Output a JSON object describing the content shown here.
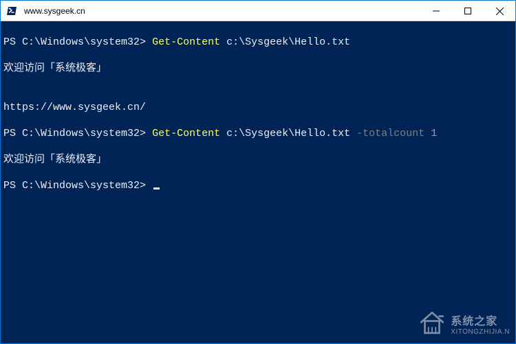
{
  "titlebar": {
    "title": "www.sysgeek.cn"
  },
  "terminal": {
    "prompt": "PS C:\\Windows\\system32>",
    "lines": [
      {
        "prompt": "PS C:\\Windows\\system32>",
        "cmd": "Get-Content",
        "arg": "c:\\Sysgeek\\Hello.txt",
        "flag": "",
        "num": ""
      },
      {
        "output": "欢迎访问「系统极客」"
      },
      {
        "output": ""
      },
      {
        "output": "https://www.sysgeek.cn/"
      },
      {
        "prompt": "PS C:\\Windows\\system32>",
        "cmd": "Get-Content",
        "arg": "c:\\Sysgeek\\Hello.txt",
        "flag": "-totalcount",
        "num": "1"
      },
      {
        "output": "欢迎访问「系统极客」"
      }
    ],
    "final_prompt": "PS C:\\Windows\\system32>"
  },
  "watermark": {
    "main": "系统之家",
    "sub": "XITONGZHIJIA.N"
  },
  "colors": {
    "terminal_bg": "#012456",
    "text": "#eeedf0",
    "cmd": "#ffff60",
    "flag": "#808080",
    "num": "#c080c0",
    "titlebar_bg": "#ffffff",
    "border": "#0078d7"
  }
}
